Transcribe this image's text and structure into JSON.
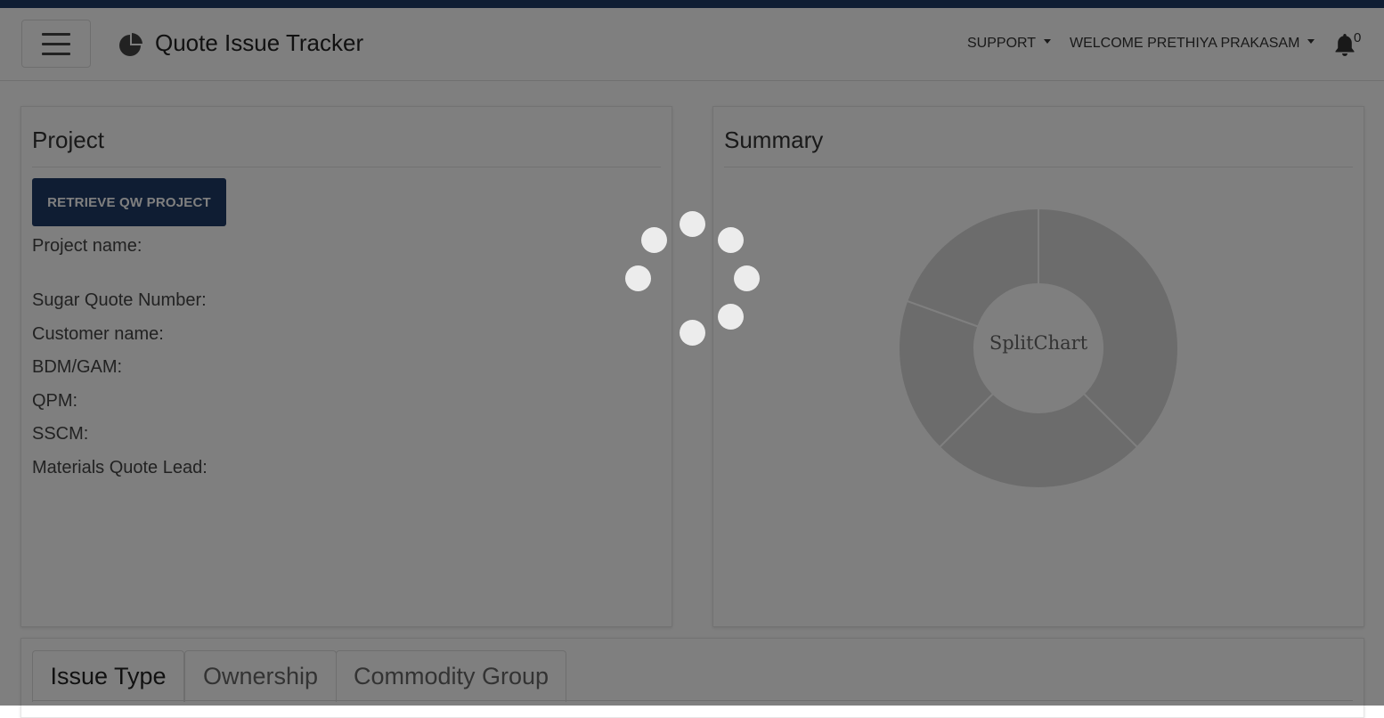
{
  "app": {
    "title": "Quote Issue Tracker",
    "accent_color": "#1e3a66",
    "brand_icon": "pie-chart-icon"
  },
  "navbar": {
    "menu_icon": "hamburger-icon",
    "support_label": "SUPPORT",
    "user_label": "WELCOME PRETHIYA PRAKASAM",
    "notification_icon": "bell-icon",
    "notification_count": "0"
  },
  "project_card": {
    "title": "Project",
    "retrieve_button": "RETRIEVE QW PROJECT",
    "fields": {
      "project_name": "Project name:",
      "sugar_quote_number": "Sugar Quote Number:",
      "customer_name": "Customer name:",
      "bdm_gam": "BDM/GAM:",
      "qpm": "QPM:",
      "sscm": "SSCM:",
      "materials_quote_lead": "Materials Quote Lead:"
    }
  },
  "summary_card": {
    "title": "Summary",
    "chart_center_label": "SplitChart"
  },
  "chart_data": {
    "type": "pie",
    "style": "donut",
    "slices": [
      {
        "value": 37.5
      },
      {
        "value": 25
      },
      {
        "value": 18
      },
      {
        "value": 19.5
      }
    ],
    "center_label": "SplitChart",
    "colors": [
      "#d9d9d9"
    ]
  },
  "tabs": [
    {
      "label": "Issue Type",
      "active": true
    },
    {
      "label": "Ownership",
      "active": false
    },
    {
      "label": "Commodity Group",
      "active": false
    }
  ],
  "loading_overlay": {
    "visible": true,
    "spinner_icon": "loading-spinner-icon"
  }
}
